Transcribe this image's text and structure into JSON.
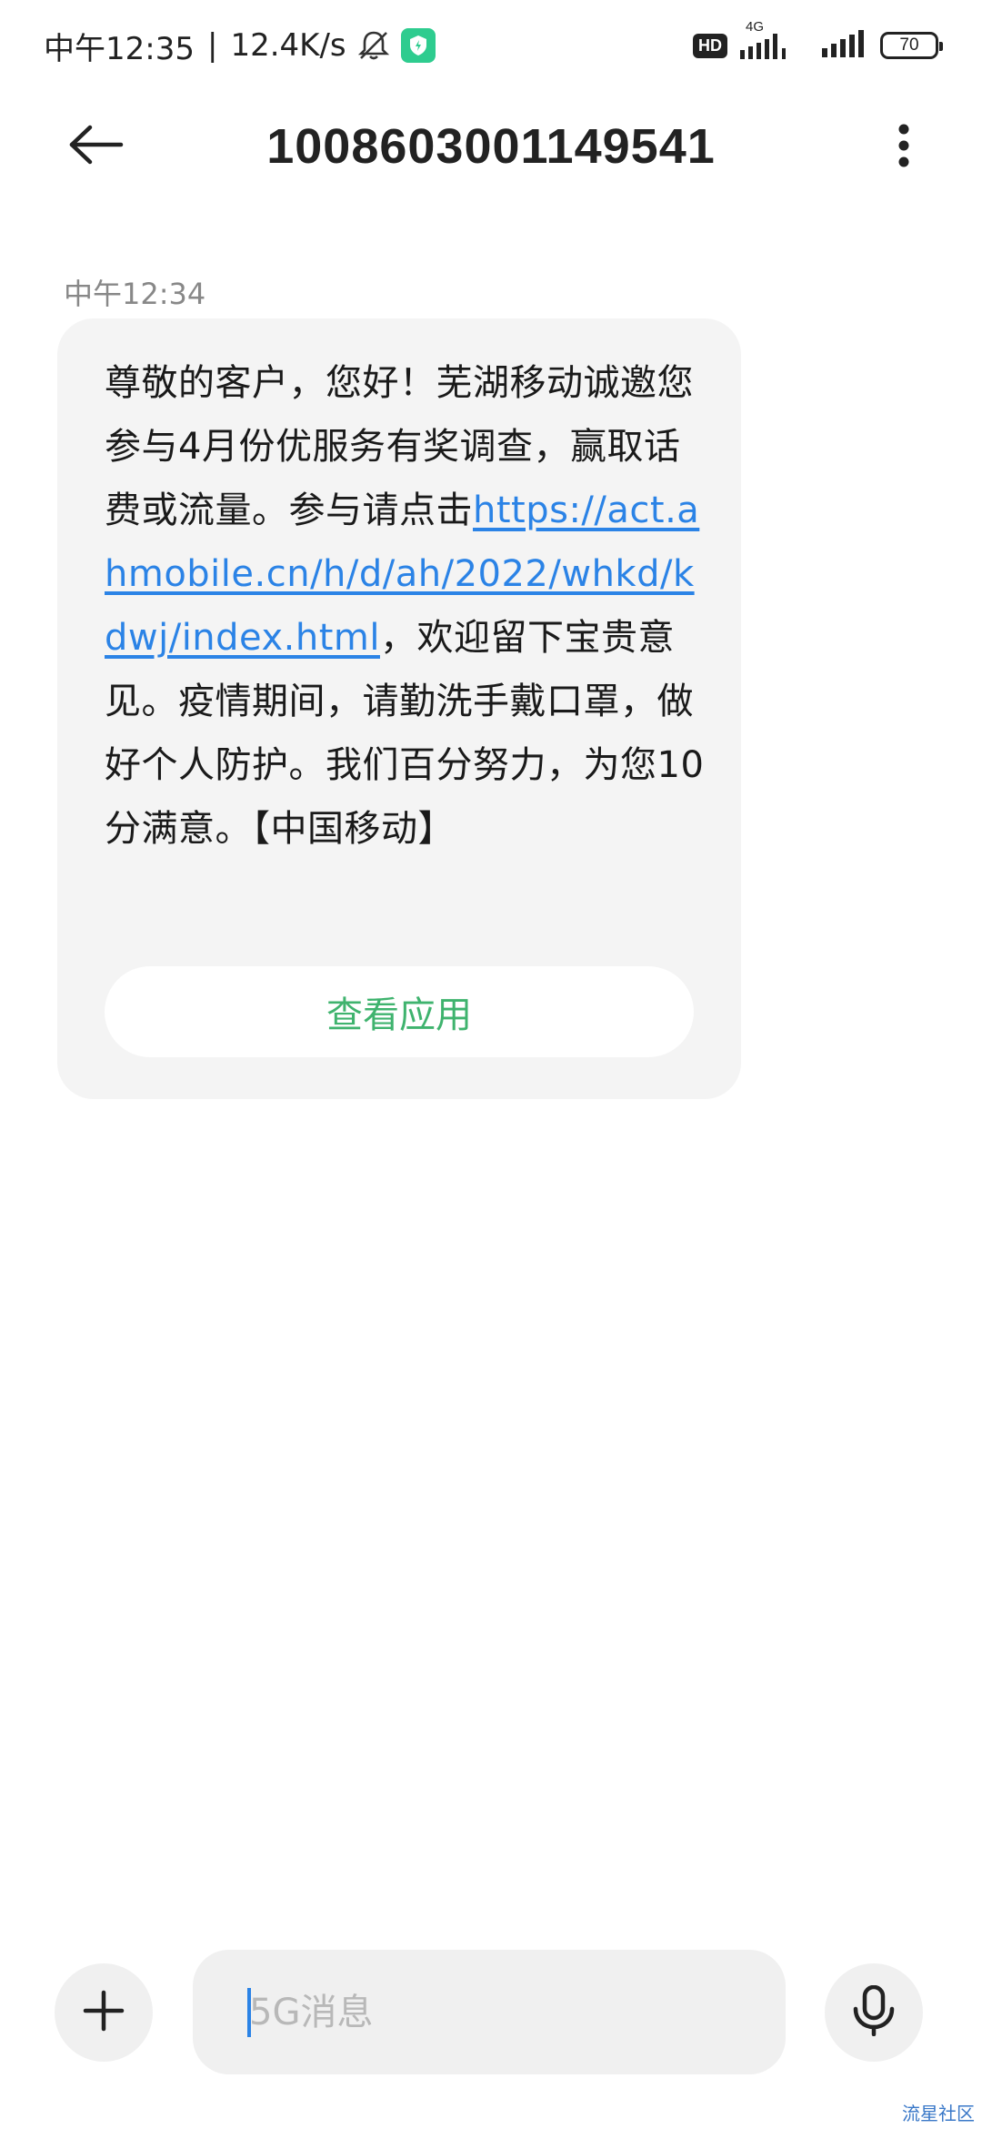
{
  "status_bar": {
    "time": "中午12:35",
    "separator": "|",
    "speed": "12.4K/s",
    "hd_label": "HD",
    "network_type": "4G",
    "battery": "70",
    "icons": [
      "bell-off-icon",
      "app-badge-icon",
      "signal-icon",
      "battery-icon"
    ]
  },
  "header": {
    "title": "1008603001149541",
    "back_icon": "arrow-left-icon",
    "more_icon": "more-vertical-icon"
  },
  "message": {
    "time": "中午12:34",
    "text_before_link": "尊敬的客户，您好！芜湖移动诚邀您参与4月份优服务有奖调查，赢取话费或流量。参与请点击",
    "link": "https://act.ahmobile.cn/h/d/ah/2022/whkd/kdwj/index.html",
    "text_after_link": "，欢迎留下宝贵意见。疫情期间，请勤洗手戴口罩，做好个人防护。我们百分努力，为您10分满意。【中国移动】",
    "action_button": "查看应用"
  },
  "composer": {
    "placeholder": "5G消息",
    "plus_icon": "plus-icon",
    "mic_icon": "microphone-icon"
  },
  "watermark": "流星社区",
  "colors": {
    "link": "#2b83e6",
    "action": "#3fb36e",
    "bubble": "#f4f4f4"
  }
}
